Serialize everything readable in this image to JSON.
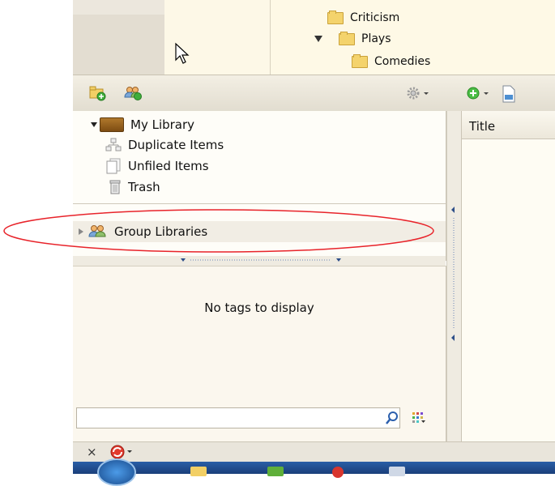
{
  "top_tree": {
    "items": [
      {
        "label": "Criticism",
        "expanded": null
      },
      {
        "label": "Plays",
        "expanded": true
      },
      {
        "label": "Comedies",
        "expanded": null
      }
    ]
  },
  "toolbar": {
    "icons": [
      "new-collection-icon",
      "new-group-icon",
      "actions-gear-icon",
      "add-item-icon",
      "new-note-icon"
    ]
  },
  "collections": {
    "library": {
      "label": "My Library"
    },
    "items": [
      {
        "label": "Duplicate Items",
        "icon": "duplicate-items-icon"
      },
      {
        "label": "Unfiled Items",
        "icon": "unfiled-items-icon"
      },
      {
        "label": "Trash",
        "icon": "trash-icon"
      }
    ],
    "group_libraries": {
      "label": "Group Libraries"
    }
  },
  "tag_selector": {
    "empty_message": "No tags to display",
    "search_value": ""
  },
  "items_pane": {
    "column_header": "Title"
  },
  "annotation": {
    "color": "#e8232a"
  }
}
